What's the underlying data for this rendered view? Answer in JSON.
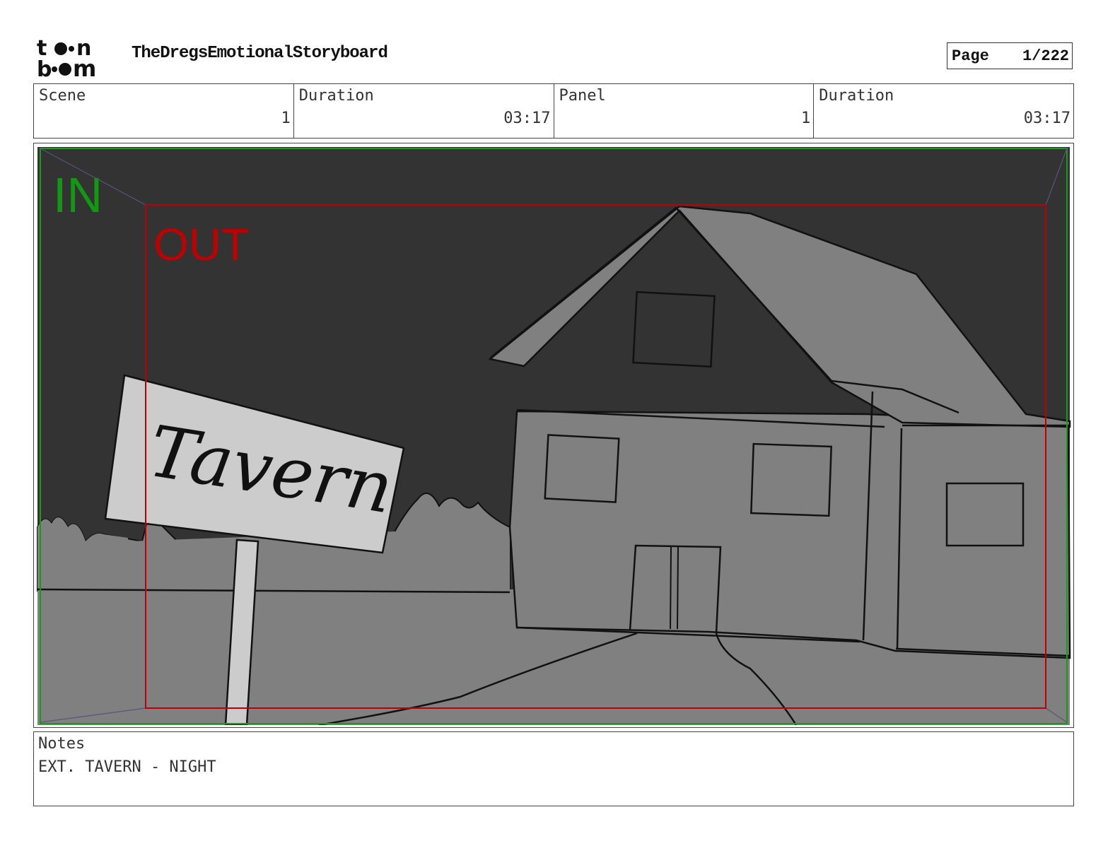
{
  "header": {
    "logo_top": "t",
    "logo_top_end": "n",
    "logo_bottom_start": "b",
    "logo_bottom_end": "m",
    "project_title": "TheDregsEmotionalStoryboard",
    "page_label": "Page",
    "page_value": "1/222"
  },
  "info": {
    "scene_label": "Scene",
    "scene_value": "1",
    "scene_duration_label": "Duration",
    "scene_duration_value": "03:17",
    "panel_label": "Panel",
    "panel_value": "1",
    "panel_duration_label": "Duration",
    "panel_duration_value": "03:17"
  },
  "panel": {
    "in_label": "IN",
    "out_label": "OUT",
    "sign_text": "Tavern",
    "colors": {
      "sky": "#333333",
      "ground": "#808080",
      "sign": "#cccccc",
      "in_frame": "#1a9a1a",
      "out_frame": "#c00000",
      "camera_lines": "#55557a"
    }
  },
  "notes": {
    "label": "Notes",
    "text": "EXT. TAVERN - NIGHT"
  }
}
